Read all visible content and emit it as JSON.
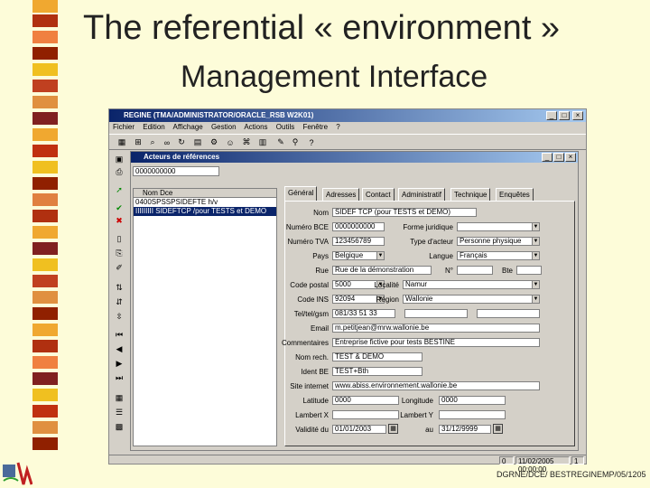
{
  "slide": {
    "title": "The referential « environment »",
    "subtitle": "Management Interface",
    "footer": "DGRNE/DCE/ BESTREGINEMP/05/1205"
  },
  "window": {
    "title": "REGINE (TMA/ADMINISTRATOR/ORACLE_RSB W2K01)",
    "menu": [
      "Fichier",
      "Edition",
      "Affichage",
      "Gestion",
      "Actions",
      "Outils",
      "Fenêtre",
      "?"
    ],
    "inner_title": "Acteurs de références",
    "selector_value": "0000000000",
    "list_header": "Nom Dce",
    "list_rows": [
      "0400SPSSPSIDEFTE h/v",
      "IIIIIIIII SIDEFTCP /pour TESTS et DEMO"
    ],
    "tabs": [
      "Général",
      "Adresses",
      "Contact",
      "Administratif",
      "Technique",
      "Enquêtes"
    ],
    "form": {
      "nom_label": "Nom",
      "nom_value": "SIDEF TCP (pour TESTS et DEMO)",
      "numero_bce_label": "Numéro BCE",
      "numero_bce_value": "0000000000",
      "forme_juridique_label": "Forme juridique",
      "forme_juridique_value": "",
      "numero_tva_label": "Numéro TVA",
      "numero_tva_value": "123456789",
      "type_acteur_label": "Type d'acteur",
      "type_acteur_value": "Personne physique",
      "pays_label": "Pays",
      "pays_value": "Belgique",
      "langue_label": "Langue",
      "langue_value": "Français",
      "rue_label": "Rue",
      "rue_value": "Rue de la démonstration",
      "numero_label": "N°",
      "numero_value": "",
      "bte_label": "Bte",
      "bte_value": "",
      "code_postal_label": "Code postal",
      "code_postal_value": "5000",
      "localite_label": "Localité",
      "localite_value": "Namur",
      "code_ins_label": "Code INS",
      "code_ins_value": "92094",
      "region_label": "Région",
      "region_value": "Wallonie",
      "telephone_label": "Tel/tel/gsm",
      "telephone_value": "081/33 51 33",
      "email_label": "Email",
      "email_value": "m.petitjean@mrw.wallonie.be",
      "commentaires_label": "Commentaires",
      "commentaires_value": "Entreprise fictive pour tests BESTINE",
      "nom_recherche_label": "Nom rech.",
      "nom_recherche_value": "TEST & DEMO",
      "ident_label": "Ident BE",
      "ident_value": "TEST+Bth",
      "site_label": "Site internet",
      "site_value": "www.abiss.environnement.wallonie.be",
      "latitude_label": "Latitude",
      "latitude_value": "0000",
      "longitude_label": "Longitude",
      "longitude_value": "0000",
      "lambert_x_label": "Lambert X",
      "lambert_x_value": "",
      "lambert_y_label": "Lambert Y",
      "lambert_y_value": "",
      "validite_label": "Validité du",
      "validite_from": "01/01/2003",
      "validite_au_label": "au",
      "validite_to": "31/12/9999"
    },
    "status": {
      "count": "0",
      "datetime": "11/02/2005 00:00:00",
      "page": "1"
    }
  }
}
